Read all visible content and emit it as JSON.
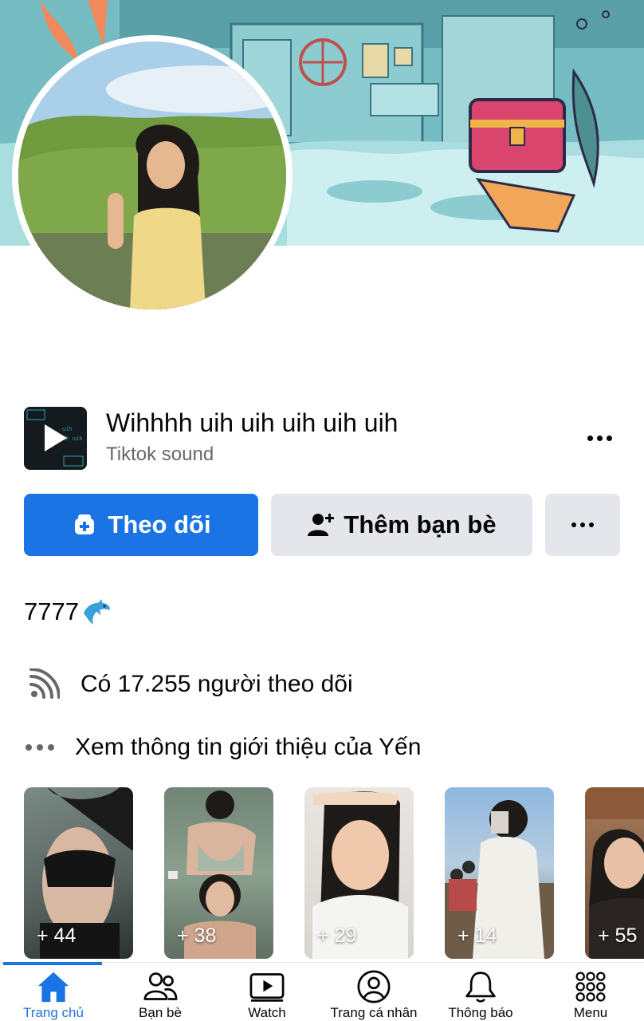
{
  "profile": {
    "bio": "7777",
    "bio_emoji": "🐬",
    "followers_text": "Có 17.255 người theo dõi",
    "about_text": "Xem thông tin giới thiệu của Yến"
  },
  "now_playing": {
    "title": "Wihhhh uih uih uih uih uih",
    "subtitle": "Tiktok sound"
  },
  "actions": {
    "follow_label": "Theo dõi",
    "add_friend_label": "Thêm bạn bè"
  },
  "photos": [
    {
      "count": "+ 44"
    },
    {
      "count": "+ 38"
    },
    {
      "count": "+ 29"
    },
    {
      "count": "+ 14"
    },
    {
      "count": "+ 55"
    }
  ],
  "nav": [
    {
      "label": "Trang chủ",
      "icon": "home-icon",
      "active": true
    },
    {
      "label": "Bạn bè",
      "icon": "friends-icon",
      "active": false
    },
    {
      "label": "Watch",
      "icon": "watch-icon",
      "active": false
    },
    {
      "label": "Trang cá nhân",
      "icon": "profile-icon",
      "active": false
    },
    {
      "label": "Thông báo",
      "icon": "bell-icon",
      "active": false
    },
    {
      "label": "Menu",
      "icon": "menu-grid-icon",
      "active": false
    }
  ],
  "colors": {
    "primary": "#1b74e4",
    "secondary_button": "#e4e6eb",
    "text": "#050505",
    "muted_text": "#65676b"
  }
}
